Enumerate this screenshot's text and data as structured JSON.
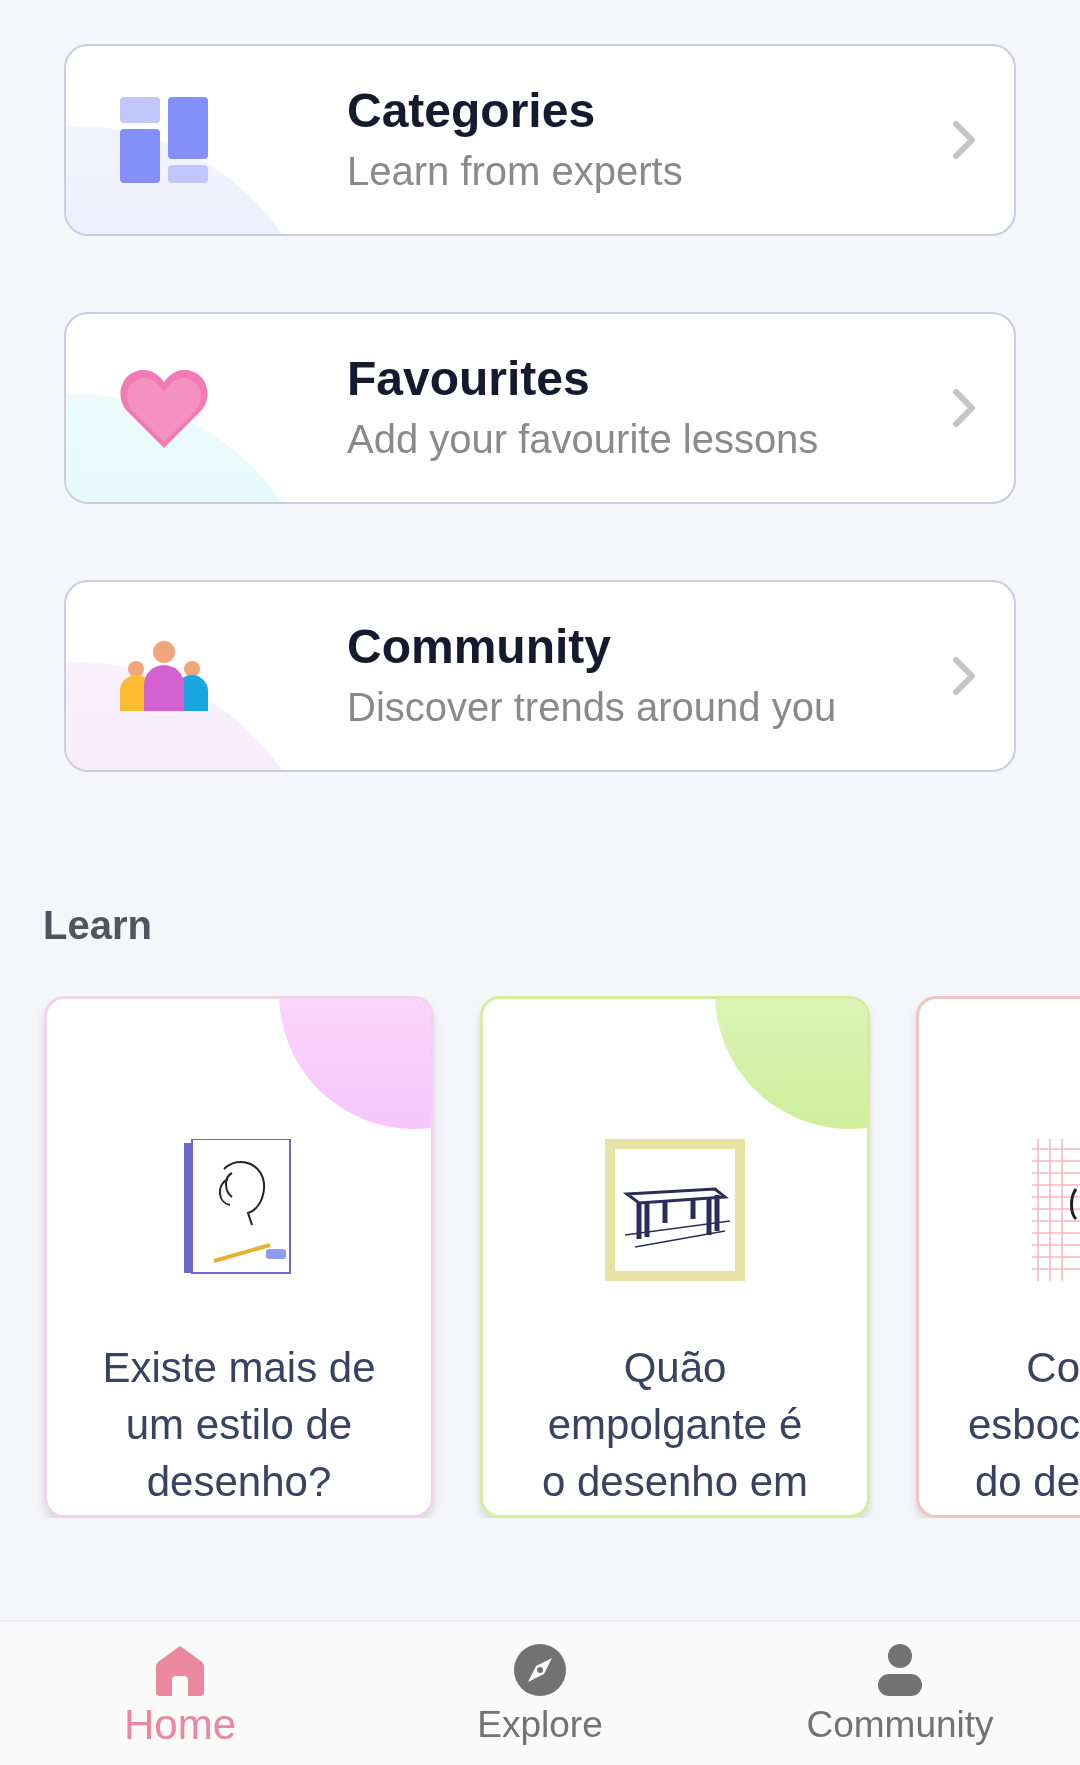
{
  "menu_cards": [
    {
      "kind": "categories",
      "title": "Categories",
      "subtitle": "Learn from experts"
    },
    {
      "kind": "favourites",
      "title": "Favourites",
      "subtitle": "Add your favourite lessons"
    },
    {
      "kind": "community",
      "title": "Community",
      "subtitle": "Discover trends around you"
    }
  ],
  "learn": {
    "heading": "Learn",
    "cards": [
      {
        "kind": "portrait",
        "lines": [
          "Existe mais de",
          "um estilo de",
          "desenho?"
        ]
      },
      {
        "kind": "table",
        "lines": [
          "Quão",
          "empolgante é",
          "o desenho em"
        ]
      },
      {
        "kind": "grid",
        "clipped": true,
        "lines": [
          "Co",
          "esboc",
          "do de"
        ]
      }
    ]
  },
  "bottom_nav": [
    {
      "kind": "home",
      "label": "Home",
      "selected": true
    },
    {
      "kind": "explore",
      "label": "Explore",
      "selected": false
    },
    {
      "kind": "profile",
      "label": "Community",
      "selected": false
    }
  ]
}
